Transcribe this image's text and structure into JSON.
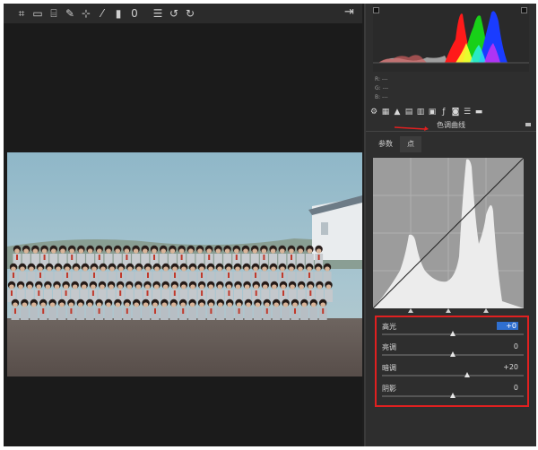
{
  "toolbar": {
    "tools": [
      {
        "name": "crop-icon",
        "glyph": "⌗"
      },
      {
        "name": "straighten-icon",
        "glyph": "▭"
      },
      {
        "name": "transform-icon",
        "glyph": "⌸"
      },
      {
        "name": "spot-removal-icon",
        "glyph": "✎"
      },
      {
        "name": "red-eye-icon",
        "glyph": "⊹"
      },
      {
        "name": "brush-icon",
        "glyph": "⁄"
      },
      {
        "name": "graduated-filter-icon",
        "glyph": "▮"
      },
      {
        "name": "radial-filter-icon",
        "glyph": "0"
      },
      {
        "name": "preferences-icon",
        "glyph": "☰"
      },
      {
        "name": "rotate-ccw-icon",
        "glyph": "↺"
      },
      {
        "name": "rotate-cw-icon",
        "glyph": "↻"
      }
    ],
    "exit_icon": "exit-fullscreen-icon"
  },
  "readout": {
    "r": "R:  ---",
    "g": "G:  ---",
    "b": "B:  ---"
  },
  "panel_icons": [
    "basic-icon",
    "tone-curve-icon",
    "detail-icon",
    "hsl-icon",
    "split-toning-icon",
    "lens-icon",
    "effects-icon",
    "camera-calibration-icon",
    "presets-icon",
    "snapshots-icon"
  ],
  "section": {
    "title": "色调曲线"
  },
  "tabs": [
    {
      "label": "参数",
      "active": true
    },
    {
      "label": "点",
      "active": false
    }
  ],
  "sliders": [
    {
      "label": "高光",
      "value": "+0",
      "level": 0.5,
      "highlight": true
    },
    {
      "label": "亮调",
      "value": "0",
      "level": 0.5,
      "highlight": false
    },
    {
      "label": "暗调",
      "value": "+20",
      "level": 0.6,
      "highlight": false
    },
    {
      "label": "阴影",
      "value": "0",
      "level": 0.5,
      "highlight": false
    }
  ],
  "colors": {
    "accent": "#e02020",
    "selection": "#2f6fcf",
    "panel_bg": "#2e2e2e",
    "canvas_bg": "#1b1b1b"
  }
}
